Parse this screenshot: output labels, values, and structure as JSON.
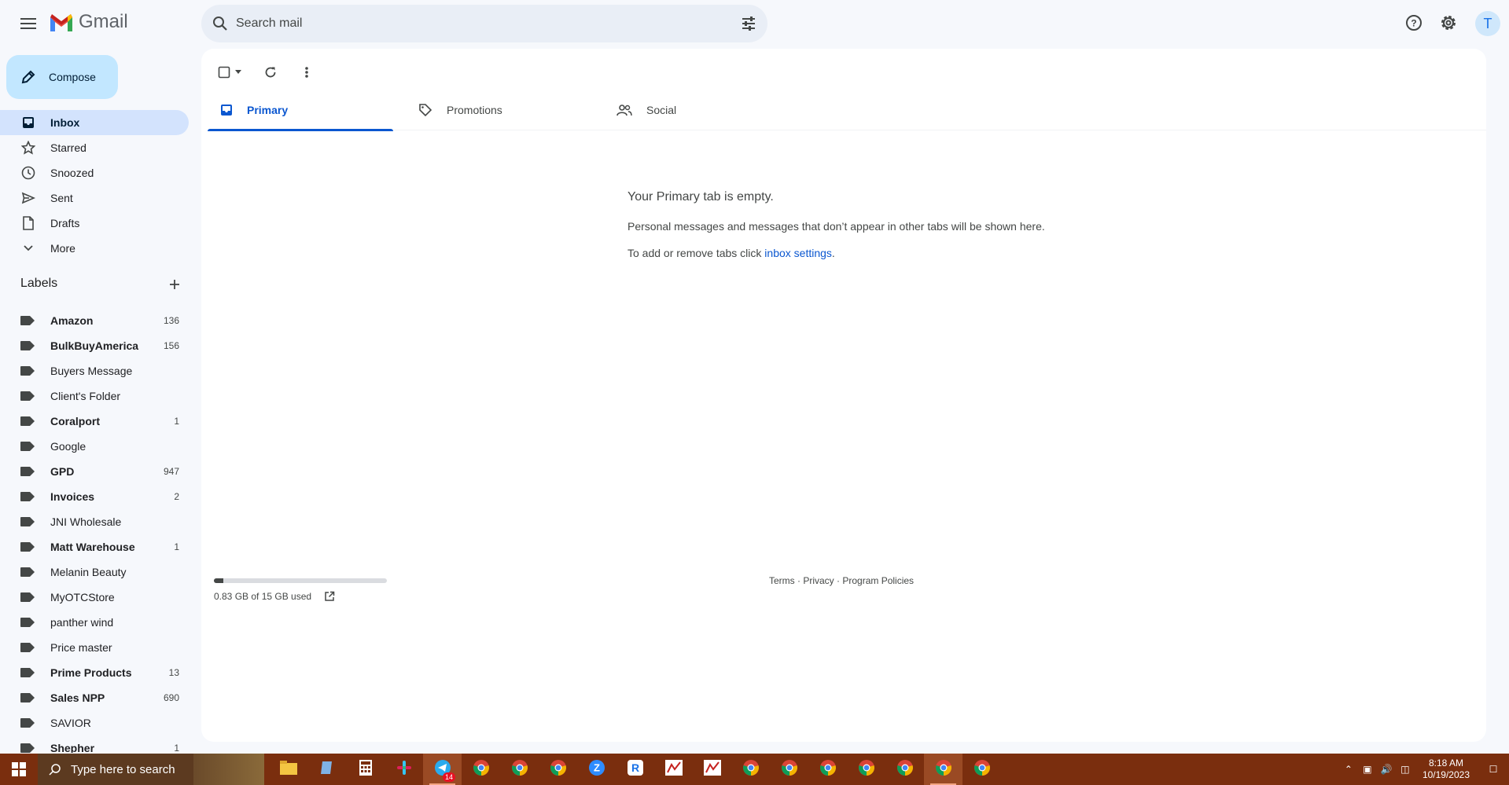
{
  "app": {
    "name": "Gmail"
  },
  "search": {
    "placeholder": "Search mail"
  },
  "header": {
    "avatar_initial": "T"
  },
  "compose": {
    "label": "Compose"
  },
  "nav": [
    {
      "label": "Inbox",
      "icon": "inbox-icon",
      "active": true
    },
    {
      "label": "Starred",
      "icon": "star-icon"
    },
    {
      "label": "Snoozed",
      "icon": "clock-icon"
    },
    {
      "label": "Sent",
      "icon": "send-icon"
    },
    {
      "label": "Drafts",
      "icon": "draft-icon"
    },
    {
      "label": "More",
      "icon": "chevron-down-icon"
    }
  ],
  "labels": {
    "title": "Labels",
    "items": [
      {
        "name": "Amazon",
        "count": "136",
        "bold": true
      },
      {
        "name": "BulkBuyAmerica",
        "count": "156",
        "bold": true
      },
      {
        "name": "Buyers Message",
        "count": "",
        "bold": false
      },
      {
        "name": "Client's Folder",
        "count": "",
        "bold": false
      },
      {
        "name": "Coralport",
        "count": "1",
        "bold": true
      },
      {
        "name": "Google",
        "count": "",
        "bold": false
      },
      {
        "name": "GPD",
        "count": "947",
        "bold": true
      },
      {
        "name": "Invoices",
        "count": "2",
        "bold": true
      },
      {
        "name": "JNI Wholesale",
        "count": "",
        "bold": false
      },
      {
        "name": "Matt Warehouse",
        "count": "1",
        "bold": true
      },
      {
        "name": "Melanin Beauty",
        "count": "",
        "bold": false
      },
      {
        "name": "MyOTCStore",
        "count": "",
        "bold": false
      },
      {
        "name": "panther wind",
        "count": "",
        "bold": false
      },
      {
        "name": "Price master",
        "count": "",
        "bold": false
      },
      {
        "name": "Prime Products",
        "count": "13",
        "bold": true
      },
      {
        "name": "Sales NPP",
        "count": "690",
        "bold": true
      },
      {
        "name": "SAVIOR",
        "count": "",
        "bold": false
      },
      {
        "name": "Shepher",
        "count": "1",
        "bold": true
      }
    ]
  },
  "tabs": [
    {
      "label": "Primary",
      "icon": "inbox-icon",
      "active": true
    },
    {
      "label": "Promotions",
      "icon": "tag-icon",
      "active": false
    },
    {
      "label": "Social",
      "icon": "people-icon",
      "active": false
    }
  ],
  "empty_state": {
    "title": "Your Primary tab is empty.",
    "description": "Personal messages and messages that don’t appear in other tabs will be shown here.",
    "settings_prefix": "To add or remove tabs click ",
    "settings_link": "inbox settings",
    "settings_suffix": "."
  },
  "storage": {
    "text": "0.83 GB of 15 GB used",
    "fraction": 0.055
  },
  "footer": {
    "terms": "Terms",
    "sep": " · ",
    "privacy": "Privacy",
    "policies": "Program Policies"
  },
  "taskbar": {
    "search_placeholder": "Type here to search",
    "time": "8:18 AM",
    "date": "10/19/2023",
    "apps": [
      "file-explorer-icon",
      "notepad-icon",
      "calculator-icon",
      "slack-icon",
      "telegram-icon",
      "chrome-icon",
      "chrome-icon",
      "chrome-icon",
      "zoom-icon",
      "r-app-icon",
      "chart-app-icon",
      "chart-app-icon",
      "chrome-icon",
      "chrome-icon",
      "chrome-icon",
      "chrome-icon",
      "chrome-icon",
      "chrome-icon",
      "chrome-icon"
    ],
    "telegram_badge": "14"
  },
  "colors": {
    "accent": "#0b57d0",
    "compose_bg": "#c2e7ff",
    "active_nav": "#d3e3fd",
    "taskbar": "#7a2e0e"
  }
}
